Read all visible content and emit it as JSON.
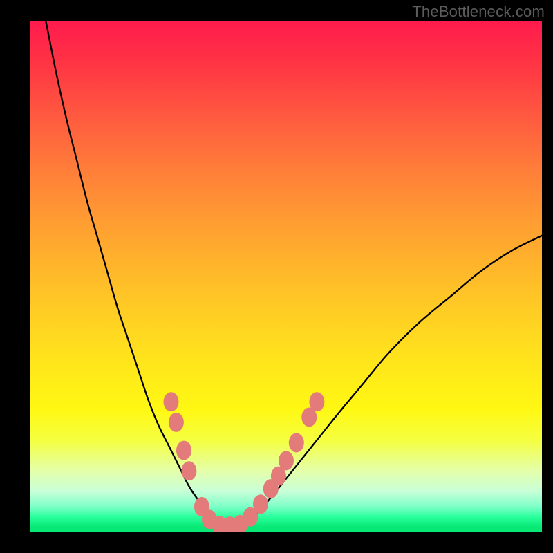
{
  "watermark": "TheBottleneck.com",
  "colors": {
    "page_bg": "#000000",
    "curve": "#000000",
    "marker_fill": "#e37b7b",
    "marker_stroke": "#d86a6a"
  },
  "chart_data": {
    "type": "line",
    "title": "",
    "xlabel": "",
    "ylabel": "",
    "xlim": [
      0,
      100
    ],
    "ylim": [
      0,
      100
    ],
    "grid": false,
    "legend": false,
    "series": [
      {
        "name": "bottleneck-curve",
        "x": [
          3,
          5,
          7,
          9,
          11,
          13,
          15,
          17,
          19,
          21,
          23,
          25,
          27,
          29,
          31,
          33,
          35,
          37,
          39,
          42,
          45,
          48,
          52,
          56,
          60,
          65,
          70,
          76,
          82,
          88,
          94,
          100
        ],
        "y": [
          100,
          90,
          81,
          73,
          65,
          58,
          51,
          44,
          38,
          32,
          26,
          21,
          17,
          13,
          9,
          6,
          3,
          1.5,
          1,
          2,
          4.5,
          8,
          13,
          18,
          23,
          29,
          35,
          41,
          46,
          51,
          55,
          58
        ]
      }
    ],
    "markers": {
      "name": "highlight-dots",
      "points": [
        {
          "x": 27.5,
          "y": 25.5
        },
        {
          "x": 28.5,
          "y": 21.5
        },
        {
          "x": 30.0,
          "y": 16.0
        },
        {
          "x": 31.0,
          "y": 12.0
        },
        {
          "x": 33.5,
          "y": 5.0
        },
        {
          "x": 35.0,
          "y": 2.5
        },
        {
          "x": 37.0,
          "y": 1.3
        },
        {
          "x": 39.0,
          "y": 1.2
        },
        {
          "x": 41.0,
          "y": 1.5
        },
        {
          "x": 43.0,
          "y": 3.0
        },
        {
          "x": 45.0,
          "y": 5.5
        },
        {
          "x": 47.0,
          "y": 8.5
        },
        {
          "x": 48.5,
          "y": 11.0
        },
        {
          "x": 50.0,
          "y": 14.0
        },
        {
          "x": 52.0,
          "y": 17.5
        },
        {
          "x": 54.5,
          "y": 22.5
        },
        {
          "x": 56.0,
          "y": 25.5
        }
      ]
    }
  }
}
